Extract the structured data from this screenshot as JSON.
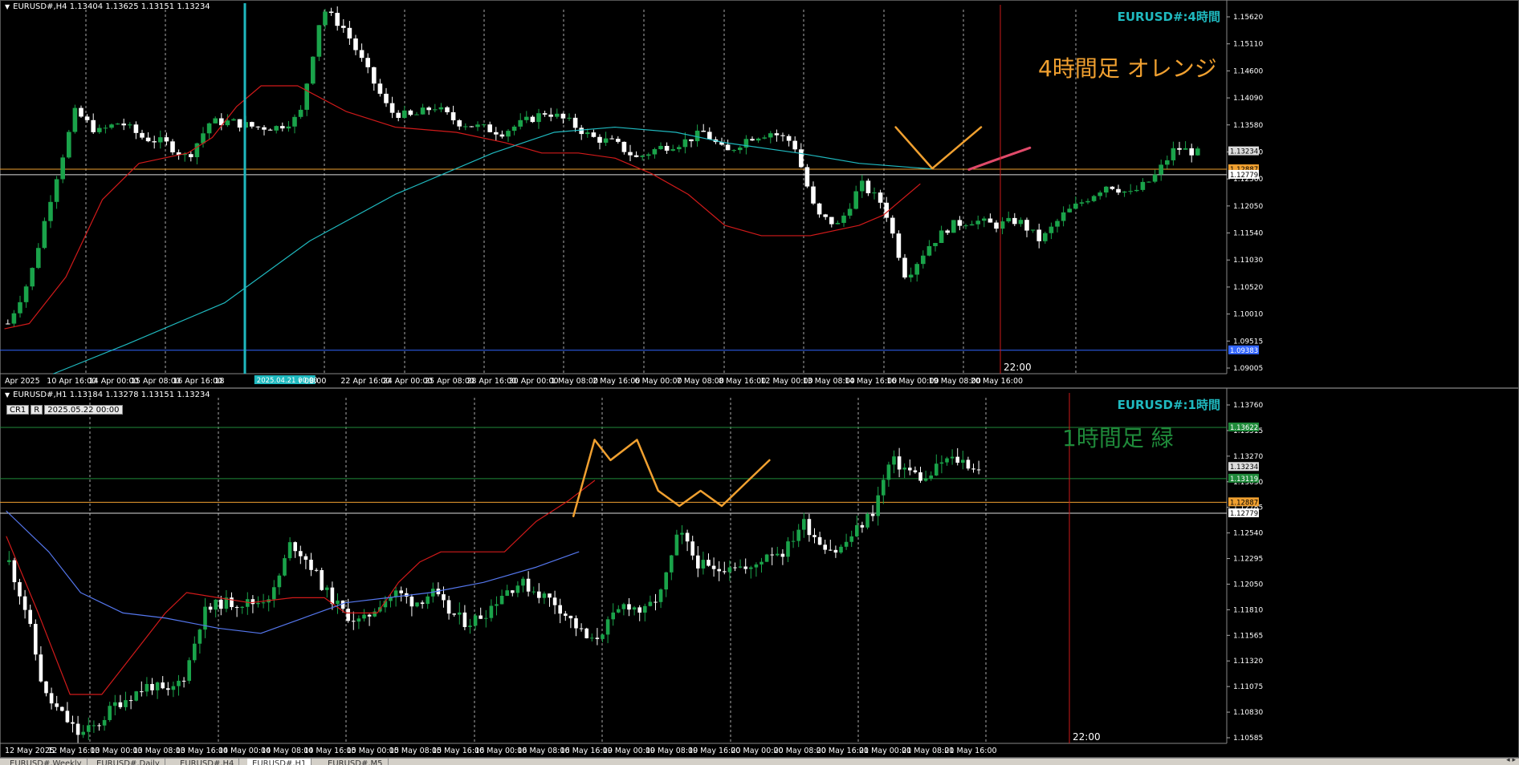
{
  "colors": {
    "bg": "#000000",
    "bull": "#1aa34a",
    "bear": "#ffffff",
    "ma_red": "#d11a1a",
    "ma_cyan": "#1fb9bf",
    "ma_blue": "#5577ee",
    "orange": "#f0a030",
    "green_line": "#1f8a3a",
    "vline": "#cc1a1a",
    "text": "#ffffff",
    "h4_note": "#f0a030",
    "h1_note": "#1f8a3a"
  },
  "h4": {
    "title": "EURUSD#,H4  1.13404 1.13625 1.13151 1.13234",
    "symbol_label": "EURUSD#:4時間",
    "note": "4時間足  オレンジ",
    "price_scale": [
      "1.15620",
      "1.15110",
      "1.14600",
      "1.14090",
      "1.13580",
      "1.13070",
      "1.12560",
      "1.12050",
      "1.11540",
      "1.11030",
      "1.10520",
      "1.10010",
      "1.09515",
      "1.09005"
    ],
    "price_tags": {
      "current": "1.13234",
      "orange": "1.12887",
      "white": "1.12779",
      "blue": "1.09383"
    },
    "time_labels": [
      "Apr 2025",
      "10 Apr 16:00",
      "14 Apr 00:00",
      "15 Apr 08:00",
      "16 Apr 16:00",
      "18",
      "2025.04.21 00:00",
      "r 08:00",
      "22 Apr 16:00",
      "24 Apr 00:00",
      "25 Apr 08:00",
      "28 Apr 16:00",
      "30 Apr 00:00",
      "1 May 08:00",
      "2 May 16:00",
      "6 May 00:00",
      "7 May 08:00",
      "8 May 16:00",
      "12 May 00:00",
      "13 May 08:00",
      "14 May 16:00",
      "16 May 00:00",
      "19 May 08:00",
      "20 May 16:00"
    ],
    "future_time": "22:00",
    "chart_data": {
      "type": "candlestick",
      "symbol": "EURUSD#",
      "timeframe": "H4",
      "open": 1.13404,
      "high": 1.13625,
      "low": 1.13151,
      "close": 1.13234,
      "ylim": [
        1.0893,
        1.1585
      ],
      "horizontal_lines": [
        1.12887,
        1.12779,
        1.09383
      ],
      "series": [
        {
          "name": "",
          "type": "candles",
          "path_y": [
            1.099,
            1.108,
            1.125,
            1.14,
            1.136,
            1.138,
            1.135,
            1.134,
            1.131,
            1.138,
            1.138,
            1.137,
            1.137,
            1.139,
            1.16,
            1.156,
            1.148,
            1.14,
            1.139,
            1.141,
            1.138,
            1.137,
            1.136,
            1.138,
            1.14,
            1.138,
            1.135,
            1.134,
            1.131,
            1.133,
            1.134,
            1.136,
            1.132,
            1.135,
            1.136,
            1.134,
            1.12,
            1.118,
            1.126,
            1.122,
            1.108,
            1.114,
            1.118,
            1.119,
            1.118,
            1.119,
            1.115,
            1.12,
            1.123,
            1.126,
            1.124,
            1.127,
            1.133,
            1.132
          ]
        },
        {
          "name": "",
          "type": "ma",
          "points": [
            [
              0,
              1.098
            ],
            [
              4,
              1.099
            ],
            [
              10,
              1.108
            ],
            [
              16,
              1.123
            ],
            [
              22,
              1.13
            ],
            [
              30,
              1.132
            ],
            [
              34,
              1.135
            ],
            [
              38,
              1.141
            ],
            [
              42,
              1.145
            ],
            [
              48,
              1.145
            ],
            [
              56,
              1.14
            ],
            [
              64,
              1.137
            ],
            [
              74,
              1.136
            ],
            [
              82,
              1.134
            ],
            [
              88,
              1.132
            ],
            [
              94,
              1.132
            ],
            [
              100,
              1.131
            ],
            [
              106,
              1.128
            ],
            [
              112,
              1.124
            ],
            [
              118,
              1.118
            ],
            [
              124,
              1.116
            ],
            [
              132,
              1.116
            ],
            [
              140,
              1.118
            ],
            [
              144,
              1.12
            ],
            [
              150,
              1.126
            ]
          ]
        },
        {
          "name": "",
          "type": "ma",
          "points": [
            [
              8,
              1.0893
            ],
            [
              20,
              1.095
            ],
            [
              36,
              1.103
            ],
            [
              50,
              1.115
            ],
            [
              64,
              1.124
            ],
            [
              80,
              1.132
            ],
            [
              90,
              1.136
            ],
            [
              100,
              1.137
            ],
            [
              110,
              1.136
            ],
            [
              118,
              1.134
            ],
            [
              130,
              1.132
            ],
            [
              140,
              1.13
            ],
            [
              152,
              1.1289
            ]
          ]
        },
        {
          "name": "",
          "type": "forecast",
          "points": [
            [
              146,
              1.137
            ],
            [
              152,
              1.129
            ],
            [
              156,
              1.133
            ],
            [
              160,
              1.137
            ]
          ]
        }
      ]
    }
  },
  "h1": {
    "title": "EURUSD#,H1  1.13184 1.13278 1.13151 1.13234",
    "tag_buttons": [
      "CR1",
      "R"
    ],
    "date_box": "2025.05.22 00:00",
    "symbol_label": "EURUSD#:1時間",
    "note": "1時間足  緑",
    "price_scale": [
      "1.13760",
      "1.13515",
      "1.13270",
      "1.13030",
      "1.12785",
      "1.12540",
      "1.12295",
      "1.12050",
      "1.11810",
      "1.11565",
      "1.11320",
      "1.11075",
      "1.10830",
      "1.10585"
    ],
    "price_tags": {
      "green_top": "1.13622",
      "current": "1.13234",
      "green_mid": "1.13119",
      "orange": "1.12887",
      "white": "1.12779"
    },
    "time_labels": [
      "12 May 2025",
      "12 May 16:00",
      "13 May 00:00",
      "13 May 08:00",
      "13 May 16:00",
      "14 May 00:00",
      "14 May 08:00",
      "14 May 16:00",
      "15 May 00:00",
      "15 May 08:00",
      "15 May 16:00",
      "16 May 00:00",
      "16 May 08:00",
      "16 May 16:00",
      "19 May 00:00",
      "19 May 08:00",
      "19 May 16:00",
      "20 May 00:00",
      "20 May 08:00",
      "20 May 16:00",
      "21 May 00:00",
      "21 May 08:00",
      "21 May 16:00"
    ],
    "future_time": "22:00",
    "chart_data": {
      "type": "candlestick",
      "symbol": "EURUSD#",
      "timeframe": "H1",
      "open": 1.13184,
      "high": 1.13278,
      "low": 1.13151,
      "close": 1.13234,
      "ylim": [
        1.1052,
        1.1385
      ],
      "horizontal_lines": [
        1.13622,
        1.13119,
        1.12887,
        1.12779
      ],
      "series": [
        {
          "name": "",
          "type": "candles",
          "path_y": [
            1.123,
            1.118,
            1.11,
            1.108,
            1.106,
            1.107,
            1.109,
            1.11,
            1.111,
            1.11,
            1.112,
            1.118,
            1.119,
            1.119,
            1.119,
            1.12,
            1.125,
            1.123,
            1.12,
            1.118,
            1.117,
            1.119,
            1.12,
            1.119,
            1.12,
            1.118,
            1.117,
            1.118,
            1.12,
            1.121,
            1.12,
            1.119,
            1.117,
            1.115,
            1.117,
            1.119,
            1.118,
            1.12,
            1.126,
            1.123,
            1.122,
            1.123,
            1.122,
            1.124,
            1.124,
            1.127,
            1.125,
            1.124,
            1.126,
            1.128,
            1.133,
            1.132,
            1.131,
            1.133,
            1.133,
            1.132
          ]
        },
        {
          "name": "",
          "type": "ma",
          "points": [
            [
              0,
              1.1255
            ],
            [
              6,
              1.118
            ],
            [
              12,
              1.11
            ],
            [
              18,
              1.11
            ],
            [
              24,
              1.114
            ],
            [
              30,
              1.118
            ],
            [
              34,
              1.12
            ],
            [
              40,
              1.1195
            ],
            [
              46,
              1.119
            ],
            [
              54,
              1.1195
            ],
            [
              60,
              1.1195
            ],
            [
              64,
              1.118
            ],
            [
              70,
              1.118
            ],
            [
              74,
              1.121
            ],
            [
              78,
              1.123
            ],
            [
              82,
              1.124
            ],
            [
              88,
              1.124
            ],
            [
              94,
              1.124
            ],
            [
              100,
              1.127
            ],
            [
              106,
              1.129
            ],
            [
              111,
              1.131
            ]
          ]
        },
        {
          "name": "",
          "type": "ma",
          "points": [
            [
              0,
              1.128
            ],
            [
              8,
              1.124
            ],
            [
              14,
              1.12
            ],
            [
              22,
              1.118
            ],
            [
              30,
              1.1175
            ],
            [
              40,
              1.1165
            ],
            [
              48,
              1.116
            ],
            [
              56,
              1.1175
            ],
            [
              64,
              1.119
            ],
            [
              72,
              1.1195
            ],
            [
              80,
              1.12
            ],
            [
              90,
              1.121
            ],
            [
              100,
              1.1225
            ],
            [
              108,
              1.124
            ]
          ]
        },
        {
          "name": "",
          "type": "forecast",
          "points": [
            [
              107,
              1.1275
            ],
            [
              111,
              1.135
            ],
            [
              114,
              1.133
            ],
            [
              119,
              1.135
            ],
            [
              123,
              1.13
            ],
            [
              127,
              1.1285
            ],
            [
              131,
              1.13
            ],
            [
              135,
              1.1285
            ],
            [
              140,
              1.131
            ],
            [
              144,
              1.133
            ]
          ]
        }
      ]
    }
  },
  "tabs": [
    "EURUSD#,Weekly",
    "EURUSD#,Daily",
    "EURUSD#,H4",
    "EURUSD#,H1",
    "EURUSD#,M5"
  ],
  "active_tab": 3,
  "tab_arrows": "◂ ▸"
}
